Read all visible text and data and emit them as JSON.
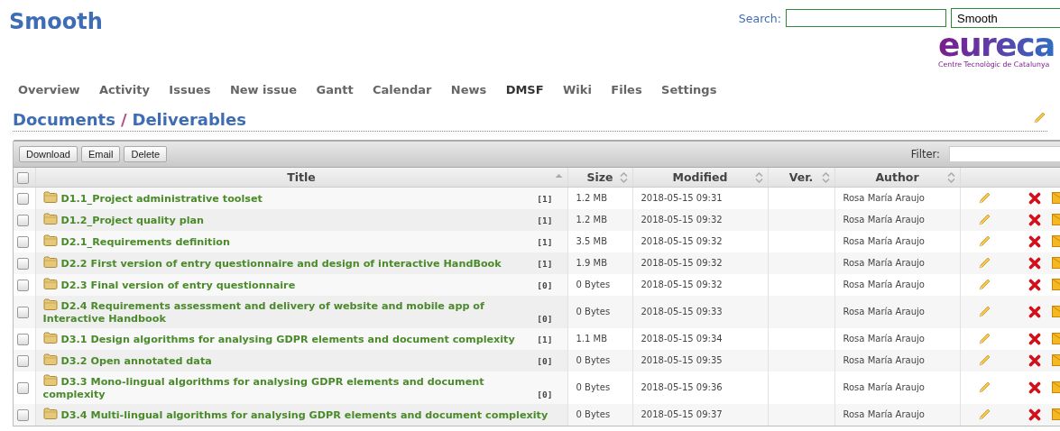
{
  "header": {
    "title": "Smooth",
    "search": {
      "label": "Search:"
    },
    "project_select": {
      "value": "Smooth"
    },
    "logo": {
      "wordmark": "eureca",
      "tagline": "Centre Tecnològic de Catalunya"
    }
  },
  "menu": [
    {
      "label": "Overview",
      "selected": false
    },
    {
      "label": "Activity",
      "selected": false
    },
    {
      "label": "Issues",
      "selected": false
    },
    {
      "label": "New issue",
      "selected": false
    },
    {
      "label": "Gantt",
      "selected": false
    },
    {
      "label": "Calendar",
      "selected": false
    },
    {
      "label": "News",
      "selected": false
    },
    {
      "label": "DMSF",
      "selected": true
    },
    {
      "label": "Wiki",
      "selected": false
    },
    {
      "label": "Files",
      "selected": false
    },
    {
      "label": "Settings",
      "selected": false
    }
  ],
  "breadcrumb": {
    "parent": "Documents",
    "separator": "/",
    "current": "Deliverables"
  },
  "toolbar": {
    "buttons": [
      "Download",
      "Email",
      "Delete"
    ],
    "filter": {
      "label": "Filter:"
    }
  },
  "table": {
    "all_checked": false,
    "columns": [
      {
        "label": "Title",
        "sorted": true
      },
      {
        "label": "Size",
        "sorted": false
      },
      {
        "label": "Modified",
        "sorted": false
      },
      {
        "label": "Ver.",
        "sorted": false
      },
      {
        "label": "Author",
        "sorted": false
      }
    ],
    "rows": [
      {
        "checked": false,
        "title": "D1.1_Project administrative toolset",
        "count": "[1]",
        "size": "1.2 MB",
        "modified": "2018-05-15 09:31",
        "author": "Rosa María Araujo"
      },
      {
        "checked": false,
        "title": "D1.2_Project quality plan",
        "count": "[1]",
        "size": "1.2 MB",
        "modified": "2018-05-15 09:32",
        "author": "Rosa María Araujo"
      },
      {
        "checked": false,
        "title": "D2.1_Requirements definition",
        "count": "[1]",
        "size": "3.5 MB",
        "modified": "2018-05-15 09:32",
        "author": "Rosa María Araujo"
      },
      {
        "checked": false,
        "title": "D2.2 First version of entry questionnaire and design of interactive HandBook",
        "count": "[1]",
        "size": "1.9 MB",
        "modified": "2018-05-15 09:32",
        "author": "Rosa María Araujo"
      },
      {
        "checked": false,
        "title": "D2.3 Final version of entry questionnaire",
        "count": "[0]",
        "size": "0 Bytes",
        "modified": "2018-05-15 09:32",
        "author": "Rosa María Araujo"
      },
      {
        "checked": false,
        "title": "D2.4 Requirements assessment and delivery of website and mobile app of Interactive Handbook",
        "count": "[0]",
        "size": "0 Bytes",
        "modified": "2018-05-15 09:33",
        "author": "Rosa María Araujo"
      },
      {
        "checked": false,
        "title": "D3.1 Design algorithms for analysing GDPR elements and document complexity",
        "count": "[1]",
        "size": "1.1 MB",
        "modified": "2018-05-15 09:34",
        "author": "Rosa María Araujo"
      },
      {
        "checked": false,
        "title": "D3.2 Open annotated data",
        "count": "[0]",
        "size": "0 Bytes",
        "modified": "2018-05-15 09:35",
        "author": "Rosa María Araujo"
      },
      {
        "checked": false,
        "title": "D3.3 Mono-lingual algorithms for analysing GDPR elements and document complexity",
        "count": "[0]",
        "size": "0 Bytes",
        "modified": "2018-05-15 09:36",
        "author": "Rosa María Araujo"
      },
      {
        "checked": false,
        "title": "D3.4 Multi-lingual algorithms for analysing GDPR elements and document complexity",
        "size": "0 Bytes",
        "modified": "2018-05-15 09:37",
        "author": "Rosa María Araujo"
      }
    ]
  }
}
